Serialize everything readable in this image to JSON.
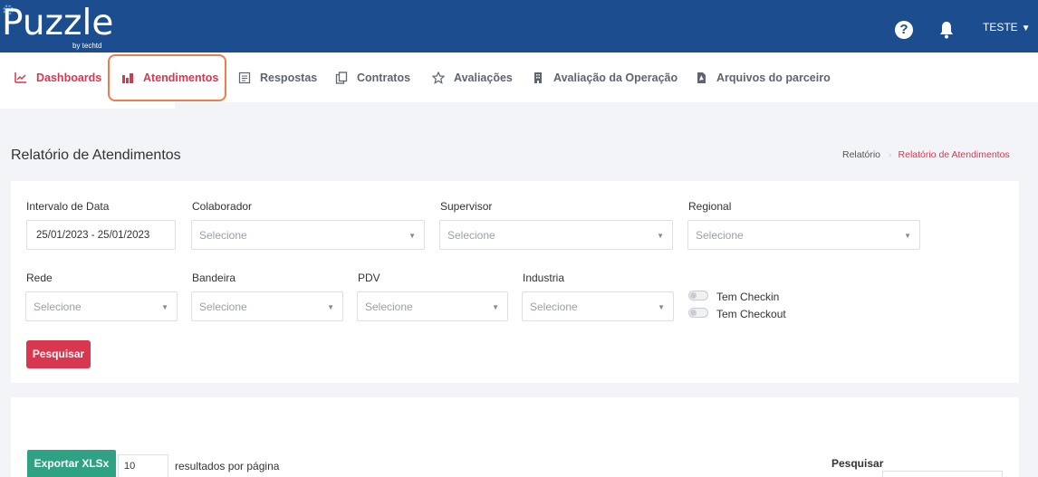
{
  "header": {
    "logo_text": "Puzzle",
    "logo_sub": "by techtd",
    "help_icon": "?",
    "user": "TESTE"
  },
  "nav": {
    "items": [
      {
        "label": "Dashboards",
        "icon": "line-chart-icon",
        "active": true
      },
      {
        "label": "Atendimentos",
        "icon": "bar-chart-icon",
        "active": true
      },
      {
        "label": "Respostas",
        "icon": "form-icon"
      },
      {
        "label": "Contratos",
        "icon": "copy-icon"
      },
      {
        "label": "Avaliações",
        "icon": "star-icon"
      },
      {
        "label": "Avaliação da Operação",
        "icon": "building-icon"
      },
      {
        "label": "Arquivos do parceiro",
        "icon": "pdf-file-icon"
      }
    ]
  },
  "page": {
    "title": "Relatório de Atendimentos",
    "breadcrumb": [
      "Relatório",
      "Relatório de Atendimentos"
    ]
  },
  "filters": {
    "date_label": "Intervalo de Data",
    "date_value": "25/01/2023 - 25/01/2023",
    "colaborador_label": "Colaborador",
    "supervisor_label": "Supervisor",
    "regional_label": "Regional",
    "rede_label": "Rede",
    "bandeira_label": "Bandeira",
    "pdv_label": "PDV",
    "industria_label": "Industria",
    "select_placeholder": "Selecione",
    "checkin_label": "Tem Checkin",
    "checkout_label": "Tem Checkout",
    "search_button": "Pesquisar"
  },
  "results": {
    "export_button": "Exportar XLSx",
    "per_page_value": "10",
    "per_page_label": "resultados por página",
    "search_label": "Pesquisar"
  },
  "colors": {
    "brand": "#1b4d8f",
    "accent": "#d8374f",
    "export": "#2ea283",
    "highlight": "#ed7d4f"
  }
}
